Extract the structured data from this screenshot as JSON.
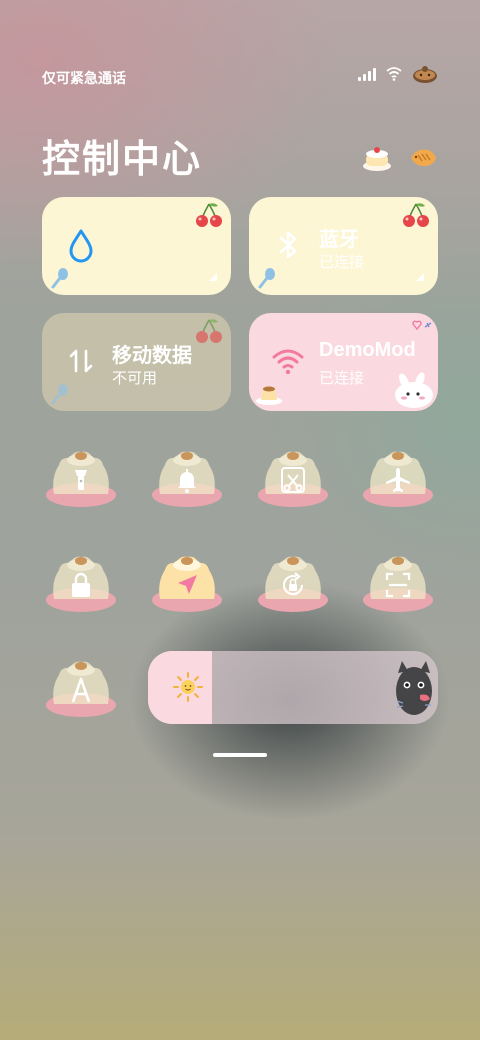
{
  "status": {
    "carrier_text": "仅可紧急通话",
    "signal_bars": 4,
    "icons": [
      "signal-icon",
      "wifi-icon",
      "battery-icon"
    ]
  },
  "header": {
    "title": "控制中心"
  },
  "tiles": {
    "data_usage": {
      "icon": "water-drop-icon",
      "line1": "",
      "line2": ""
    },
    "bluetooth": {
      "icon": "bluetooth-icon",
      "label": "蓝牙",
      "status": "已连接"
    },
    "mobile_data": {
      "icon": "mobile-data-icon",
      "label": "移动数据",
      "status": "不可用"
    },
    "wifi": {
      "icon": "wifi-icon",
      "label": "DemoMod",
      "status": "已连接"
    }
  },
  "toggles": [
    {
      "name": "flashlight",
      "icon": "flashlight-icon",
      "active": false
    },
    {
      "name": "ring",
      "icon": "bell-icon",
      "active": false
    },
    {
      "name": "screenshot",
      "icon": "scissors-icon",
      "active": false
    },
    {
      "name": "airplane",
      "icon": "airplane-icon",
      "active": false
    },
    {
      "name": "lock",
      "icon": "lock-icon",
      "active": false
    },
    {
      "name": "location",
      "icon": "location-arrow-icon",
      "active": true
    },
    {
      "name": "rotation-lock",
      "icon": "rotation-lock-icon",
      "active": false
    },
    {
      "name": "scan",
      "icon": "scan-icon",
      "active": false
    },
    {
      "name": "auto-font",
      "icon": "letter-a-icon",
      "active": false
    }
  ],
  "brightness": {
    "level": 0.22,
    "icon": "sun-icon",
    "handle_icon": "cat-icon"
  },
  "colors": {
    "tile_yellow": "#fdf6d4",
    "tile_pink": "#fbd9e0",
    "accent_blue": "#2196f3",
    "accent_pink": "#f27aa0",
    "pudding_active": "#fde2a8"
  }
}
